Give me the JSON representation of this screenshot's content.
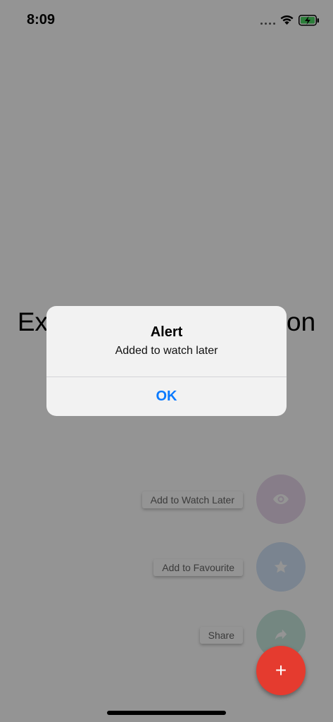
{
  "status_bar": {
    "time": "8:09",
    "wifi_icon": "wifi-icon",
    "battery_icon": "battery-charging-icon",
    "battery_color": "#4cd964"
  },
  "main": {
    "title_left": "Ex",
    "title_right": "on"
  },
  "speed_dial": {
    "items": [
      {
        "label": "Add to Watch Later",
        "icon": "eye-icon",
        "color": "#9b27af"
      },
      {
        "label": "Add to Favourite",
        "icon": "star-icon",
        "color": "#2196f3"
      },
      {
        "label": "Share",
        "icon": "share-icon",
        "color": "#23a37a"
      }
    ],
    "main_button": {
      "symbol": "+",
      "icon": "plus-icon",
      "color": "#e53b2f"
    }
  },
  "alert": {
    "title": "Alert",
    "message": "Added to watch later",
    "button_label": "OK",
    "button_color": "#0a7aff"
  }
}
